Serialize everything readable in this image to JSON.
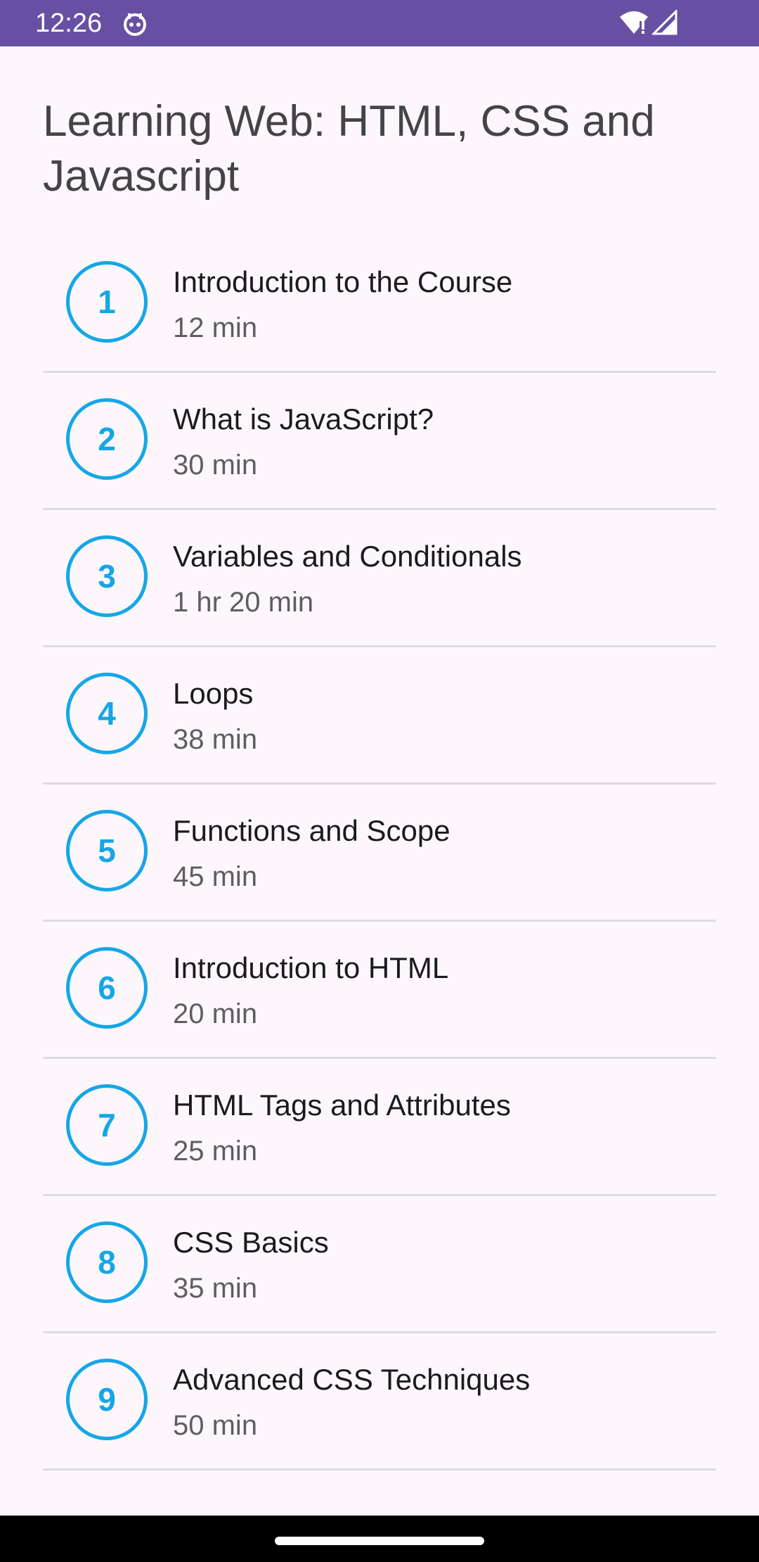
{
  "status_bar": {
    "time": "12:26",
    "app_icon": "android-notification-icon",
    "wifi_icon": "wifi-icon",
    "signal_icon": "cell-signal-icon"
  },
  "page": {
    "title": "Learning Web: HTML, CSS and Javascript"
  },
  "lessons": [
    {
      "number": "1",
      "title": "Introduction to the Course",
      "duration": "12 min"
    },
    {
      "number": "2",
      "title": "What is JavaScript?",
      "duration": "30 min"
    },
    {
      "number": "3",
      "title": "Variables and Conditionals",
      "duration": "1 hr 20 min"
    },
    {
      "number": "4",
      "title": "Loops",
      "duration": "38 min"
    },
    {
      "number": "5",
      "title": "Functions and Scope",
      "duration": "45 min"
    },
    {
      "number": "6",
      "title": "Introduction to HTML",
      "duration": "20 min"
    },
    {
      "number": "7",
      "title": "HTML Tags and Attributes",
      "duration": "25 min"
    },
    {
      "number": "8",
      "title": "CSS Basics",
      "duration": "35 min"
    },
    {
      "number": "9",
      "title": "Advanced CSS Techniques",
      "duration": "50 min"
    }
  ],
  "colors": {
    "status_bar": "#6750a4",
    "accent": "#16a6e8",
    "background": "#fdf7fc",
    "divider": "#dedcdf"
  }
}
